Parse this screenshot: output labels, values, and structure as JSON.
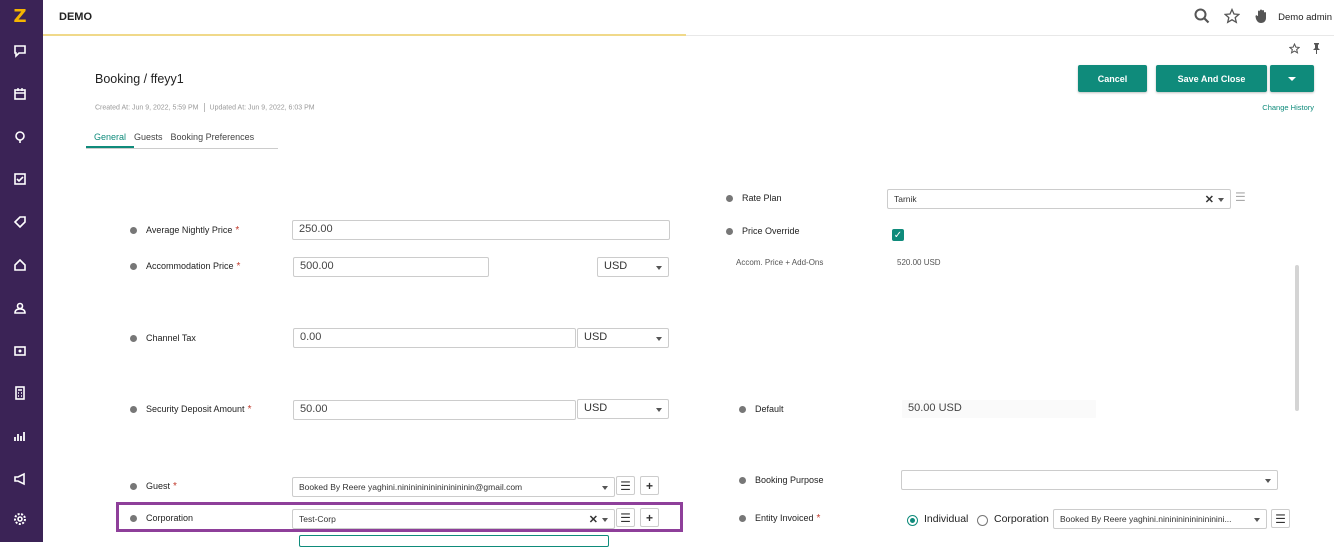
{
  "app": {
    "brand": "DEMO",
    "user": "Demo admin"
  },
  "sidebar": {
    "logo": "Z",
    "icons": [
      "chat-icon",
      "calendar-icon",
      "location-icon",
      "checklist-icon",
      "tag-icon",
      "home-icon",
      "user-icon",
      "dollar-icon",
      "calculator-icon",
      "chart-icon",
      "megaphone-icon",
      "gear-icon"
    ]
  },
  "page": {
    "breadcrumb_root": "Booking",
    "breadcrumb_sep": " / ",
    "breadcrumb_current": "ffeyy1",
    "created": "Created At: Jun 9, 2022, 5:59 PM",
    "updated": "Updated At: Jun 9, 2022, 6:03 PM",
    "change_history": "Change History"
  },
  "actions": {
    "cancel": "Cancel",
    "save_close": "Save And Close"
  },
  "tabs": [
    {
      "label": "General",
      "active": true
    },
    {
      "label": "Guests"
    },
    {
      "label": "Booking Preferences"
    }
  ],
  "form": {
    "avg_nightly": {
      "label": "Average Nightly Price",
      "required": "*",
      "value": "250.00"
    },
    "accommodation": {
      "label": "Accommodation Price",
      "required": "*",
      "value": "500.00",
      "currency": "USD"
    },
    "channel_tax": {
      "label": "Channel Tax",
      "value": "0.00",
      "currency": "USD"
    },
    "security": {
      "label": "Security Deposit Amount",
      "required": "*",
      "value": "50.00",
      "currency": "USD"
    },
    "guest": {
      "label": "Guest",
      "required": "*",
      "value": "Booked By Reere yaghini.nininininininininininin@gmail.com"
    },
    "corporation": {
      "label": "Corporation",
      "value": "Test-Corp"
    },
    "rate_plan": {
      "label": "Rate Plan",
      "value": "Tarnik"
    },
    "price_override": {
      "label": "Price Override",
      "checked": true,
      "check": "✓"
    },
    "accom_addons": {
      "label": "Accom. Price + Add-Ons",
      "value": "520.00 USD"
    },
    "default": {
      "label": "Default",
      "value": "50.00 USD"
    },
    "booking_purpose": {
      "label": "Booking Purpose",
      "value": ""
    },
    "entity_invoiced": {
      "label": "Entity Invoiced",
      "required": "*",
      "opt1": "Individual",
      "opt2": "Corporation",
      "value": "Booked By Reere yaghini.nininininininininini..."
    }
  },
  "colors": {
    "sidebar": "#3b2356",
    "accent": "#0f8b7b",
    "highlight": "#8e3f9a",
    "logo": "#f5b400"
  }
}
